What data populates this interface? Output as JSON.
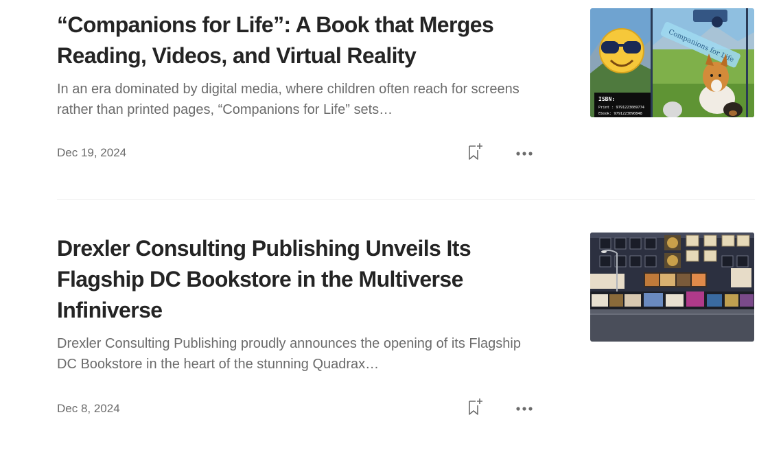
{
  "articles": [
    {
      "title": "“Companions for Life”: A Book that Merges Reading, Videos, and Virtual Reality",
      "subtitle": "In an era dominated by digital media, where children often reach for screens rather than printed pages, “Companions for Life” sets…",
      "date": "Dec 19, 2024",
      "thumbnail": {
        "isbn_label": "ISBN:",
        "print_line": "Print : 9791223089774",
        "ebook_line": "Ebook: 9791223090848",
        "banner_text": "Companions for Life"
      }
    },
    {
      "title": "Drexler Consulting Publishing Unveils Its Flagship DC Bookstore in the Multiverse Infiniverse",
      "subtitle": "Drexler Consulting Publishing proudly announces the opening of its Flagship DC Bookstore in the heart of the stunning Quadrax…",
      "date": "Dec 8, 2024"
    }
  ],
  "icons": {
    "bookmark": "bookmark-add-icon",
    "more": "more-horizontal-icon"
  },
  "colors": {
    "title": "#242424",
    "muted": "#6b6b6b",
    "divider": "#f0f0f0"
  }
}
